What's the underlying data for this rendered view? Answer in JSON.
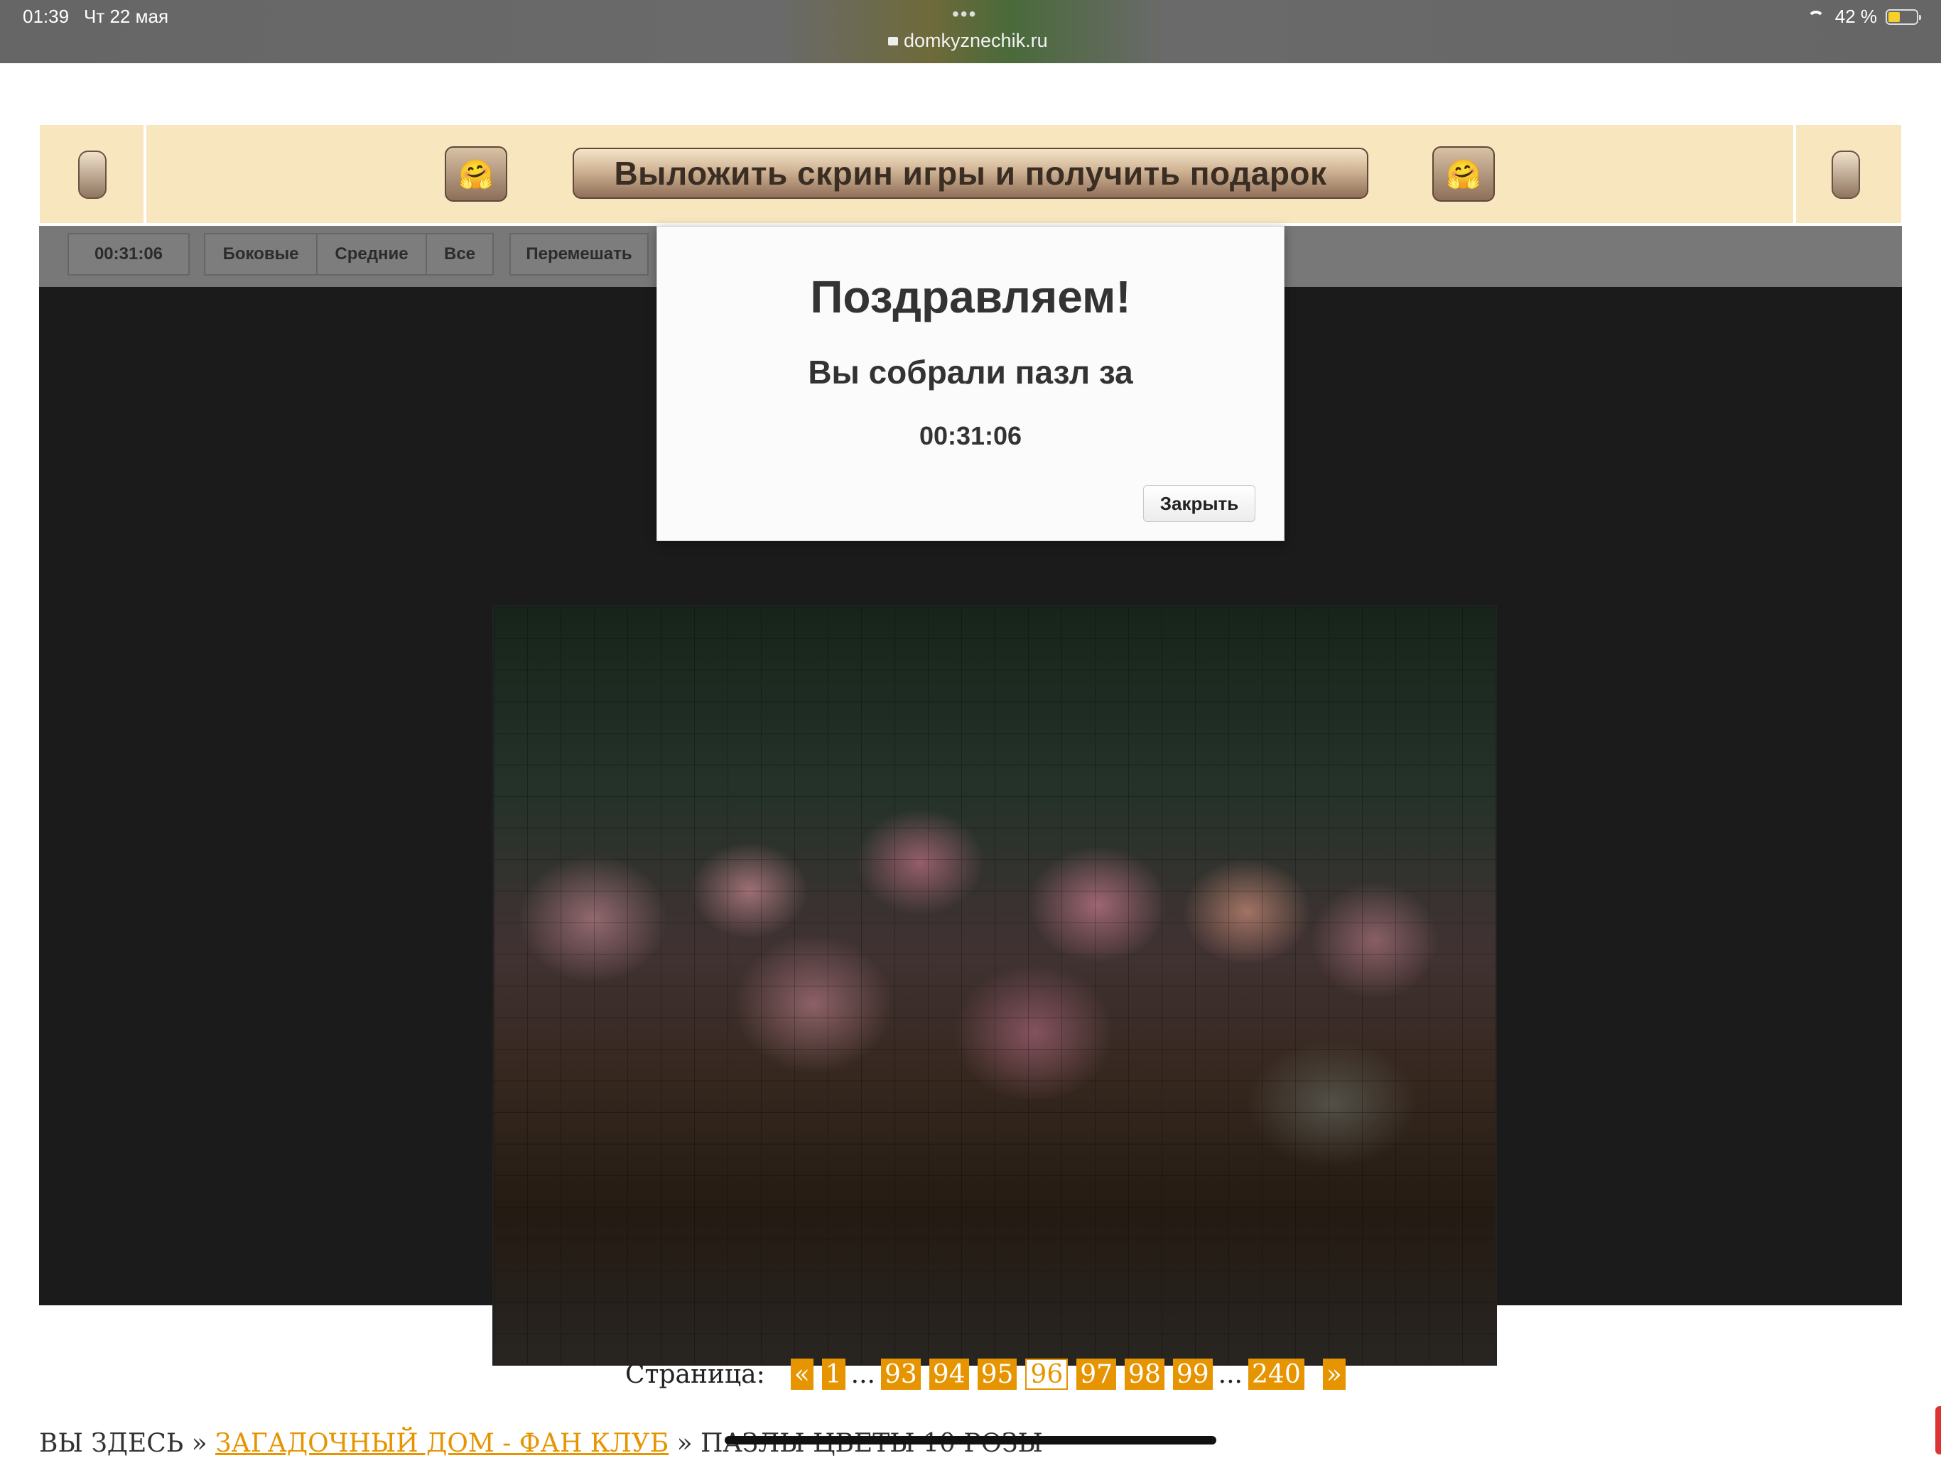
{
  "status_bar": {
    "time": "01:39",
    "date": "Чт 22 мая",
    "dots": "•••",
    "url": "domkyznechik.ru",
    "battery": "42 %",
    "battery_level": 0.42,
    "icons": [
      "wifi-icon",
      "battery-icon",
      "lock-icon"
    ]
  },
  "banner": {
    "button_label": "Выложить скрин игры и получить подарок",
    "emoji": "🤗",
    "colors": {
      "background": "#f8e6bf",
      "button_text": "#3a2d24"
    }
  },
  "toolbar": {
    "timer": "00:31:06",
    "filters": [
      "Боковые",
      "Средние",
      "Все"
    ],
    "shuffle": "Перемешать"
  },
  "modal": {
    "title": "Поздравляем!",
    "subtitle": "Вы собрали пазл за",
    "time": "00:31:06",
    "close": "Закрыть"
  },
  "pagination": {
    "label": "Страница:",
    "prev": "«",
    "next": "»",
    "ellipsis": "...",
    "pages": [
      "1",
      "93",
      "94",
      "95",
      "96",
      "97",
      "98",
      "99",
      "240"
    ],
    "current": "96",
    "accent_color": "#e69400"
  },
  "breadcrumb": {
    "prefix": "ВЫ ЗДЕСЬ",
    "sep": "»",
    "link": "ЗАГАДОЧНЫЙ ДОМ - ФАН КЛУБ",
    "current": "ПАЗЛЫ ЦВЕТЫ 10 РОЗЫ"
  }
}
